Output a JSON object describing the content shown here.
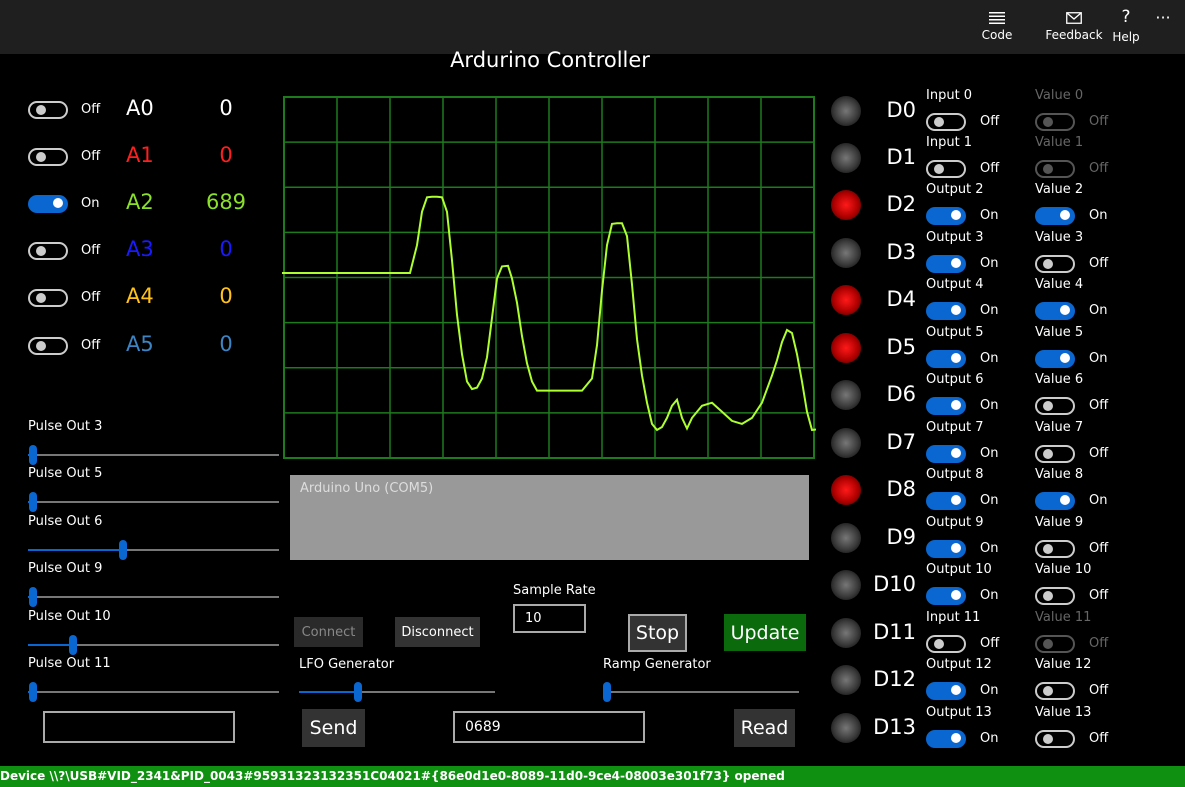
{
  "titlebar": {
    "code_label": "Code",
    "feedback_label": "Feedback",
    "help_label": "Help",
    "more_label": "···"
  },
  "app": {
    "title": "Ardurino Controller"
  },
  "analog": [
    {
      "state": "Off",
      "name": "A0",
      "value": "0",
      "color": "#ffffff"
    },
    {
      "state": "Off",
      "name": "A1",
      "value": "0",
      "color": "#ff1f1f"
    },
    {
      "state": "On",
      "name": "A2",
      "value": "689",
      "color": "#8ae02a"
    },
    {
      "state": "Off",
      "name": "A3",
      "value": "0",
      "color": "#1a1aff"
    },
    {
      "state": "Off",
      "name": "A4",
      "value": "0",
      "color": "#ffc21a"
    },
    {
      "state": "Off",
      "name": "A5",
      "value": "0",
      "color": "#3d84c4"
    }
  ],
  "pulse": [
    {
      "label": "Pulse Out 3",
      "level": 0.02
    },
    {
      "label": "Pulse Out 5",
      "level": 0.02
    },
    {
      "label": "Pulse Out 6",
      "level": 0.38
    },
    {
      "label": "Pulse Out 9",
      "level": 0.02
    },
    {
      "label": "Pulse Out 10",
      "level": 0.18
    },
    {
      "label": "Pulse Out 11",
      "level": 0.02
    }
  ],
  "console": {
    "text": "Arduino Uno (COM5)"
  },
  "controls": {
    "connect": "Connect",
    "disconnect": "Disconnect",
    "sample_rate_label": "Sample Rate",
    "sample_rate_value": "10",
    "stop": "Stop",
    "update": "Update",
    "lfo_label": "LFO Generator",
    "lfo_level": 0.3,
    "ramp_label": "Ramp Generator",
    "ramp_level": 0.02,
    "send": "Send",
    "send_input": "",
    "read_value": "0689",
    "read": "Read"
  },
  "digital": [
    {
      "name": "D0",
      "led": "off",
      "mode": "Input 0",
      "mode_state": "Off",
      "value_label": "Value 0",
      "value_state": "Off",
      "value_disabled": true
    },
    {
      "name": "D1",
      "led": "off",
      "mode": "Input 1",
      "mode_state": "Off",
      "value_label": "Value 1",
      "value_state": "Off",
      "value_disabled": true
    },
    {
      "name": "D2",
      "led": "on",
      "mode": "Output 2",
      "mode_state": "On",
      "value_label": "Value 2",
      "value_state": "On",
      "value_disabled": false
    },
    {
      "name": "D3",
      "led": "off",
      "mode": "Output 3",
      "mode_state": "On",
      "value_label": "Value 3",
      "value_state": "Off",
      "value_disabled": false
    },
    {
      "name": "D4",
      "led": "on",
      "mode": "Output 4",
      "mode_state": "On",
      "value_label": "Value 4",
      "value_state": "On",
      "value_disabled": false
    },
    {
      "name": "D5",
      "led": "on",
      "mode": "Output 5",
      "mode_state": "On",
      "value_label": "Value 5",
      "value_state": "On",
      "value_disabled": false
    },
    {
      "name": "D6",
      "led": "off",
      "mode": "Output 6",
      "mode_state": "On",
      "value_label": "Value 6",
      "value_state": "Off",
      "value_disabled": false
    },
    {
      "name": "D7",
      "led": "off",
      "mode": "Output 7",
      "mode_state": "On",
      "value_label": "Value 7",
      "value_state": "Off",
      "value_disabled": false
    },
    {
      "name": "D8",
      "led": "on",
      "mode": "Output 8",
      "mode_state": "On",
      "value_label": "Value 8",
      "value_state": "On",
      "value_disabled": false
    },
    {
      "name": "D9",
      "led": "off",
      "mode": "Output 9",
      "mode_state": "On",
      "value_label": "Value 9",
      "value_state": "Off",
      "value_disabled": false
    },
    {
      "name": "D10",
      "led": "off",
      "mode": "Output 10",
      "mode_state": "On",
      "value_label": "Value 10",
      "value_state": "Off",
      "value_disabled": false
    },
    {
      "name": "D11",
      "led": "off",
      "mode": "Input 11",
      "mode_state": "Off",
      "value_label": "Value 11",
      "value_state": "Off",
      "value_disabled": true
    },
    {
      "name": "D12",
      "led": "off",
      "mode": "Output 12",
      "mode_state": "On",
      "value_label": "Value 12",
      "value_state": "Off",
      "value_disabled": false
    },
    {
      "name": "D13",
      "led": "off",
      "mode": "Output 13",
      "mode_state": "On",
      "value_label": "Value 13",
      "value_state": "Off",
      "value_disabled": false
    }
  ],
  "colors": {
    "accent": "#0a66d0",
    "scope_grid": "#1d7a1d",
    "scope_trace": "#adff2f",
    "led_on": "#e00000",
    "status_bg": "#109010",
    "update_bg": "#0b6a0b"
  },
  "scope": {
    "trace": [
      [
        0,
        518
      ],
      [
        10,
        518
      ],
      [
        20,
        518
      ],
      [
        30,
        518
      ],
      [
        40,
        518
      ],
      [
        50,
        518
      ],
      [
        60,
        518
      ],
      [
        70,
        518
      ],
      [
        80,
        518
      ],
      [
        90,
        518
      ],
      [
        100,
        518
      ],
      [
        110,
        518
      ],
      [
        120,
        518
      ],
      [
        128,
        518
      ],
      [
        135,
        610
      ],
      [
        140,
        720
      ],
      [
        145,
        768
      ],
      [
        150,
        770
      ],
      [
        155,
        770
      ],
      [
        160,
        768
      ],
      [
        165,
        720
      ],
      [
        170,
        560
      ],
      [
        175,
        380
      ],
      [
        180,
        250
      ],
      [
        185,
        160
      ],
      [
        190,
        135
      ],
      [
        195,
        140
      ],
      [
        200,
        170
      ],
      [
        205,
        240
      ],
      [
        210,
        370
      ],
      [
        215,
        500
      ],
      [
        220,
        540
      ],
      [
        226,
        542
      ],
      [
        230,
        500
      ],
      [
        235,
        420
      ],
      [
        240,
        310
      ],
      [
        245,
        220
      ],
      [
        250,
        160
      ],
      [
        255,
        130
      ],
      [
        260,
        130
      ],
      [
        270,
        130
      ],
      [
        280,
        130
      ],
      [
        290,
        130
      ],
      [
        300,
        130
      ],
      [
        310,
        170
      ],
      [
        315,
        280
      ],
      [
        320,
        460
      ],
      [
        325,
        610
      ],
      [
        330,
        680
      ],
      [
        335,
        682
      ],
      [
        340,
        682
      ],
      [
        345,
        640
      ],
      [
        350,
        480
      ],
      [
        355,
        300
      ],
      [
        360,
        180
      ],
      [
        365,
        90
      ],
      [
        370,
        20
      ],
      [
        375,
        0
      ],
      [
        380,
        10
      ],
      [
        385,
        40
      ],
      [
        390,
        80
      ],
      [
        395,
        100
      ],
      [
        400,
        40
      ],
      [
        405,
        5
      ],
      [
        410,
        40
      ],
      [
        420,
        80
      ],
      [
        430,
        90
      ],
      [
        440,
        60
      ],
      [
        450,
        30
      ],
      [
        460,
        20
      ],
      [
        470,
        40
      ],
      [
        480,
        90
      ],
      [
        490,
        180
      ],
      [
        495,
        230
      ],
      [
        500,
        290
      ],
      [
        505,
        330
      ],
      [
        510,
        320
      ],
      [
        515,
        250
      ],
      [
        520,
        160
      ],
      [
        525,
        60
      ],
      [
        530,
        0
      ],
      [
        535,
        2
      ]
    ],
    "mid_value": 512
  },
  "status": {
    "text": "Device \\\\?\\USB#VID_2341&PID_0043#95931323132351C04021#{86e0d1e0-8089-11d0-9ce4-08003e301f73} opened"
  }
}
